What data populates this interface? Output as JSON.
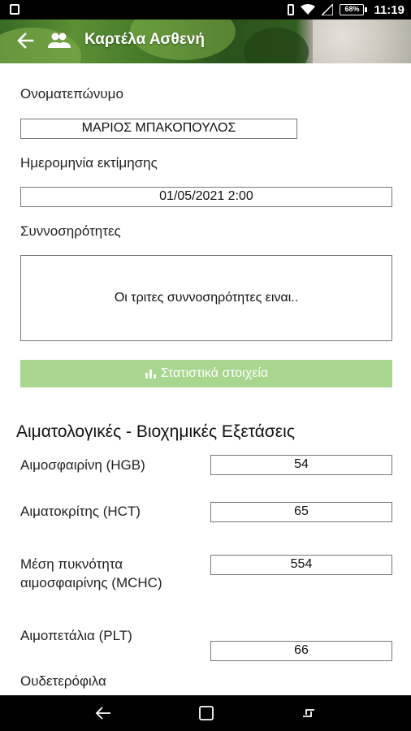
{
  "status_bar": {
    "battery_percent": "68%",
    "time": "11:19"
  },
  "app_bar": {
    "title": "Καρτέλα Ασθενή"
  },
  "patient": {
    "name_label": "Ονοματεπώνυμο",
    "name_value": "ΜΑΡΙΟΣ ΜΠΑΚΟΠΟΥΛΟΣ",
    "date_label": "Ημερομηνία εκτίμησης",
    "date_value": "01/05/2021 2:00",
    "comorbidities_label": "Συννοσηρότητες",
    "comorbidities_value": "Οι τριτες συννοσηρότητες ειναι.."
  },
  "stats_button": {
    "label": "Στατιστικά στοιχεία",
    "icon": "bar-chart-icon"
  },
  "labs": {
    "section_title": "Αιματολογικές - Βιοχημικές Εξετάσεις",
    "hgb_label": "Αιμοσφαιρίνη (HGB)",
    "hgb_value": "54",
    "hct_label": "Αιματοκρίτης (HCT)",
    "hct_value": "65",
    "mchc_label_line1": "Μέση πυκνότητα",
    "mchc_label_line2": "αιμοσφαιρίνης (MCHC)",
    "mchc_value": "554",
    "plt_label": "Αιμοπετάλια (PLT)",
    "plt_value": "66",
    "next_label_partial": "Ουδετερόφιλα"
  },
  "colors": {
    "accent_button": "#a8d68e"
  }
}
